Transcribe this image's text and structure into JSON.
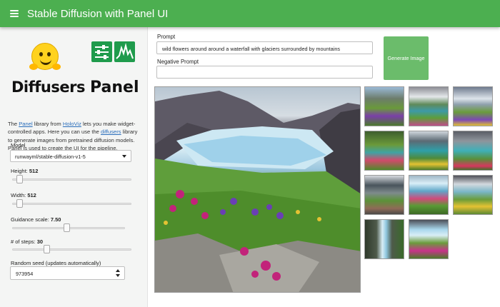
{
  "header": {
    "title": "Stable Diffusion with Panel UI"
  },
  "sidebar": {
    "logo_text_left": "Diffusers",
    "logo_text_right": "Panel",
    "intro": {
      "p1": "The ",
      "link_panel": "Panel",
      "p2": " library from ",
      "link_holoviz": "HoloViz",
      "p3": " lets you make widget-controlled apps. Here you can use the ",
      "link_diffusers": "diffusers",
      "p4": " library to generate images from pretrained diffusion models. Panel is used to create the UI for the pipeline."
    },
    "model": {
      "label": "Model",
      "selected": "runwayml/stable-diffusion-v1-5"
    },
    "height": {
      "label": "Height: ",
      "value": "512",
      "fraction": 0.04
    },
    "width": {
      "label": "Width: ",
      "value": "512",
      "fraction": 0.04
    },
    "guidance": {
      "label": "Guidance scale: ",
      "value": "7.50",
      "fraction": 0.48
    },
    "steps": {
      "label": "# of steps: ",
      "value": "30",
      "fraction": 0.28
    },
    "seed": {
      "label": "Random seed (updates automatically)",
      "value": "973954"
    }
  },
  "main": {
    "prompt": {
      "label": "Prompt",
      "value": "wild flowers around around a waterfall with glaciers surrounded by mountains"
    },
    "negative_prompt": {
      "label": "Negative Prompt",
      "value": ""
    },
    "generate_button": "Generate Image"
  },
  "colors": {
    "header": "#4caf50",
    "button": "#6bbc6b",
    "link": "#2a6ebb"
  }
}
